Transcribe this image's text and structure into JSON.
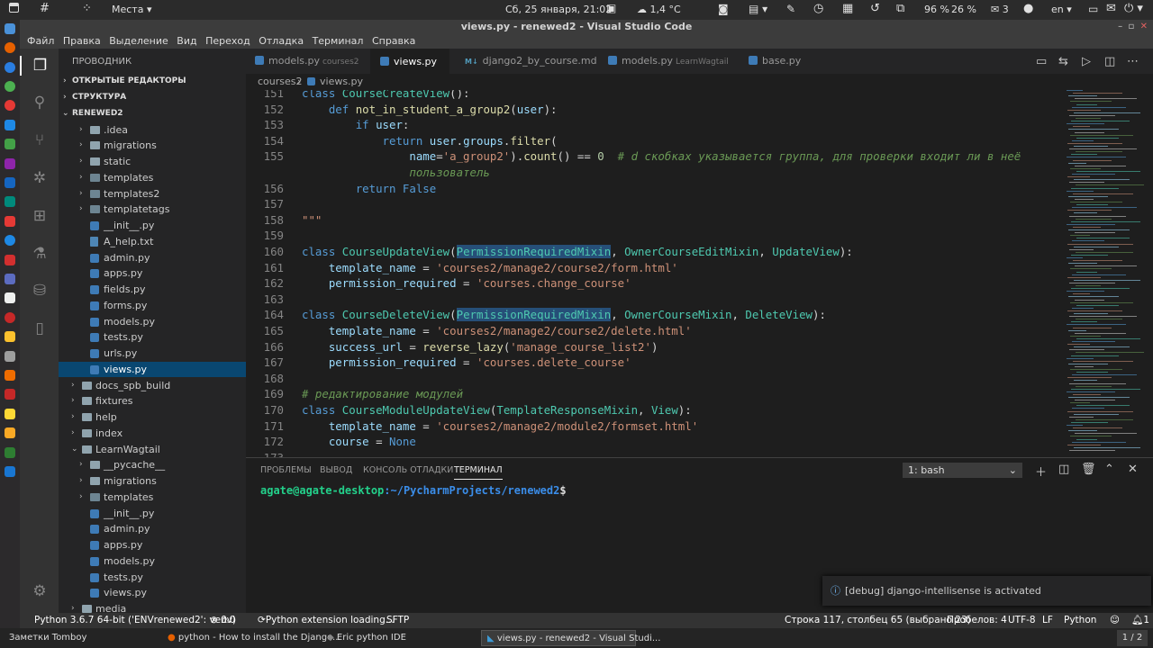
{
  "system_bar": {
    "places": "Места",
    "datetime": "Сб, 25 января, 21:02",
    "weather": "1,4 °C",
    "battery": "96 %",
    "volume": "26 %",
    "mail_count": "3",
    "lang": "en"
  },
  "window_title": "views.py - renewed2 - Visual Studio Code",
  "menu": [
    "Файл",
    "Правка",
    "Выделение",
    "Вид",
    "Переход",
    "Отладка",
    "Терминал",
    "Справка"
  ],
  "sidebar": {
    "title": "ПРОВОДНИК",
    "sections": [
      "ОТКРЫТЫЕ РЕДАКТОРЫ",
      "СТРУКТУРА",
      "RENEWED2"
    ],
    "items": [
      {
        "label": ".idea",
        "kind": "folder"
      },
      {
        "label": "migrations",
        "kind": "folder"
      },
      {
        "label": "static",
        "kind": "folder"
      },
      {
        "label": "templates",
        "kind": "folder"
      },
      {
        "label": "templates2",
        "kind": "folder"
      },
      {
        "label": "templatetags",
        "kind": "folder"
      },
      {
        "label": "__init__.py",
        "kind": "py"
      },
      {
        "label": "A_help.txt",
        "kind": "txt"
      },
      {
        "label": "admin.py",
        "kind": "py"
      },
      {
        "label": "apps.py",
        "kind": "py"
      },
      {
        "label": "fields.py",
        "kind": "py"
      },
      {
        "label": "forms.py",
        "kind": "py"
      },
      {
        "label": "models.py",
        "kind": "py"
      },
      {
        "label": "tests.py",
        "kind": "py"
      },
      {
        "label": "urls.py",
        "kind": "py"
      },
      {
        "label": "views.py",
        "kind": "py",
        "selected": true
      },
      {
        "label": "docs_spb_build",
        "kind": "folder0"
      },
      {
        "label": "fixtures",
        "kind": "folder0"
      },
      {
        "label": "help",
        "kind": "folder0"
      },
      {
        "label": "index",
        "kind": "folder0"
      },
      {
        "label": "LearnWagtail",
        "kind": "folder0open"
      },
      {
        "label": "__pycache__",
        "kind": "folder"
      },
      {
        "label": "migrations",
        "kind": "folder"
      },
      {
        "label": "templates",
        "kind": "folder"
      },
      {
        "label": "__init__.py",
        "kind": "py"
      },
      {
        "label": "admin.py",
        "kind": "py"
      },
      {
        "label": "apps.py",
        "kind": "py"
      },
      {
        "label": "models.py",
        "kind": "py"
      },
      {
        "label": "tests.py",
        "kind": "py"
      },
      {
        "label": "views.py",
        "kind": "py"
      },
      {
        "label": "media",
        "kind": "folder0"
      }
    ]
  },
  "tabs": [
    {
      "label": "models.py",
      "sub": "courses2",
      "icon": "py"
    },
    {
      "label": "views.py",
      "sub": "",
      "icon": "py",
      "active": true
    },
    {
      "label": "django2_by_course.md",
      "sub": "",
      "icon": "md"
    },
    {
      "label": "models.py",
      "sub": "LearnWagtail",
      "icon": "py"
    },
    {
      "label": "base.py",
      "sub": "",
      "icon": "py"
    }
  ],
  "breadcrumb": [
    "courses2",
    "views.py"
  ],
  "code_lines": [
    {
      "n": "151",
      "html": "<span class=\"kw\">class</span> <span class=\"cls\">CourseCreateView</span>():"
    },
    {
      "n": "152",
      "html": "    <span class=\"kw\">def</span> <span class=\"fn\">not_in_student_a_group2</span>(<span class=\"var\">user</span>):"
    },
    {
      "n": "153",
      "html": "        <span class=\"kw\">if</span> <span class=\"var\">user</span>:"
    },
    {
      "n": "154",
      "html": "            <span class=\"kw\">return</span> <span class=\"var\">user</span>.<span class=\"var\">groups</span>.<span class=\"fn\">filter</span>("
    },
    {
      "n": "155",
      "html": "                <span class=\"var\">name</span>=<span class=\"str\">'a_group2'</span>).<span class=\"fn\">count</span>() == <span class=\"num\">0</span>  <span class=\"com\"># d скобках указывается группа, для проверки входит ли в неё</span>"
    },
    {
      "n": "",
      "html": "                <span class=\"com\">пользователь</span>"
    },
    {
      "n": "156",
      "html": "        <span class=\"kw\">return</span> <span class=\"kw\">False</span>"
    },
    {
      "n": "157",
      "html": ""
    },
    {
      "n": "158",
      "html": "<span class=\"str\">\"\"\"</span>"
    },
    {
      "n": "159",
      "html": ""
    },
    {
      "n": "160",
      "html": "<span class=\"kw\">class</span> <span class=\"cls\">CourseUpdateView</span>(<span class=\"cls hl\">PermissionRequiredMixin</span>, <span class=\"cls\">OwnerCourseEditMixin</span>, <span class=\"cls\">UpdateView</span>):"
    },
    {
      "n": "161",
      "html": "    <span class=\"var\">template_name</span> = <span class=\"str\">'courses2/manage2/course2/form.html'</span>"
    },
    {
      "n": "162",
      "html": "    <span class=\"var\">permission_required</span> = <span class=\"str\">'courses.change_course'</span>"
    },
    {
      "n": "163",
      "html": ""
    },
    {
      "n": "164",
      "html": "<span class=\"kw\">class</span> <span class=\"cls\">CourseDeleteView</span>(<span class=\"cls hl\">PermissionRequiredMixin</span>, <span class=\"cls\">OwnerCourseMixin</span>, <span class=\"cls\">DeleteView</span>):"
    },
    {
      "n": "165",
      "html": "    <span class=\"var\">template_name</span> = <span class=\"str\">'courses2/manage2/course2/delete.html'</span>"
    },
    {
      "n": "166",
      "html": "    <span class=\"var\">success_url</span> = <span class=\"fn\">reverse_lazy</span>(<span class=\"str\">'manage_course_list2'</span>)"
    },
    {
      "n": "167",
      "html": "    <span class=\"var\">permission_required</span> = <span class=\"str\">'courses.delete_course'</span>"
    },
    {
      "n": "168",
      "html": ""
    },
    {
      "n": "169",
      "html": "<span class=\"com\"># редактирование модулей</span>"
    },
    {
      "n": "170",
      "html": "<span class=\"kw\">class</span> <span class=\"cls\">CourseModuleUpdateView</span>(<span class=\"cls\">TemplateResponseMixin</span>, <span class=\"cls\">View</span>):"
    },
    {
      "n": "171",
      "html": "    <span class=\"var\">template_name</span> = <span class=\"str\">'courses2/manage2/module2/formset.html'</span>"
    },
    {
      "n": "172",
      "html": "    <span class=\"var\">course</span> = <span class=\"kw\">None</span>"
    },
    {
      "n": "173",
      "html": ""
    }
  ],
  "panel": {
    "tabs": [
      "ПРОБЛЕМЫ",
      "ВЫВОД",
      "КОНСОЛЬ ОТЛАДКИ",
      "ТЕРМИНАЛ"
    ],
    "shell": "1: bash",
    "prompt_user": "agate@agate-desktop",
    "prompt_path": ":~/PycharmProjects/renewed2",
    "prompt_end": "$"
  },
  "toast": "[debug] django-intellisense is activated",
  "status": {
    "python": "Python 3.6.7 64-bit ('ENVrenewed2': venv)",
    "errors": "0",
    "warnings": "0",
    "loading": "Python extension loading...",
    "sftp": "SFTP",
    "position": "Строка 117, столбец 65 (выбрано 23)",
    "spaces": "Пробелов: 4",
    "encoding": "UTF-8",
    "eol": "LF",
    "language": "Python",
    "notifications": "1"
  },
  "taskbar": {
    "items": [
      "Заметки Tomboy",
      "python - How to install the Django...",
      "Eric python IDE",
      "views.py - renewed2 - Visual Studi..."
    ],
    "workspace": "1 / 2"
  },
  "colors": {
    "accent": "#094771",
    "statusbar": "#333333",
    "prompt_user": "#23d18b",
    "prompt_path": "#3b8eea"
  }
}
